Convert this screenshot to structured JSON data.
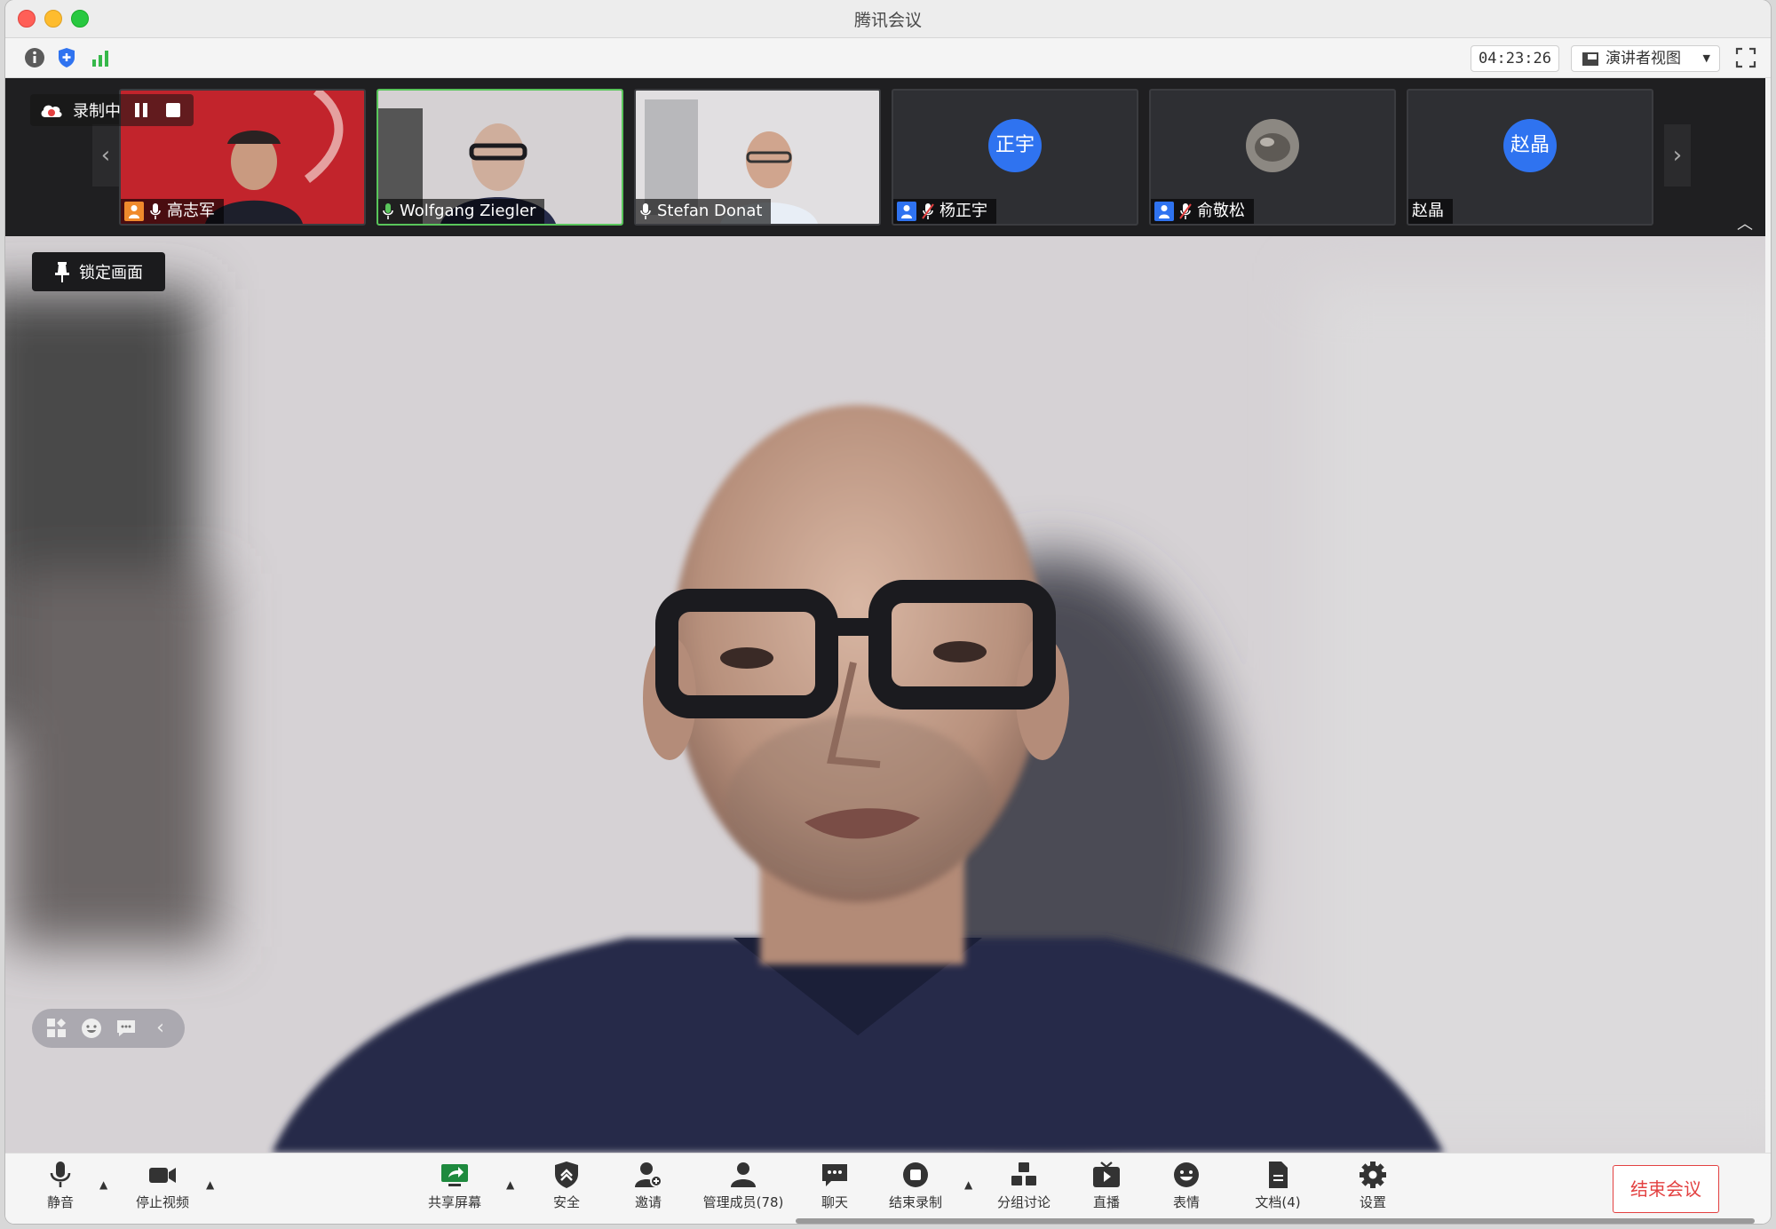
{
  "window": {
    "title": "腾讯会议"
  },
  "infobar": {
    "timer": "04:23:26",
    "view_mode": "演讲者视图",
    "icons": [
      "info-icon",
      "security-shield-icon",
      "network-signal-icon",
      "fullscreen-icon"
    ]
  },
  "recording": {
    "label": "录制中"
  },
  "participants": [
    {
      "name": "高志军",
      "video": true,
      "host": true,
      "mic": "on"
    },
    {
      "name": "Wolfgang Ziegler",
      "video": true,
      "active_speaker": true,
      "mic": "speaking"
    },
    {
      "name": "Stefan Donat",
      "video": true,
      "mic": "on"
    },
    {
      "name": "杨正宇",
      "avatar_text": "正宇",
      "mic": "muted",
      "badge": true
    },
    {
      "name": "俞敬松",
      "avatar_photo": true,
      "mic": "muted",
      "badge": true
    },
    {
      "name": "赵晶",
      "avatar_text": "赵晶",
      "mic": "none"
    }
  ],
  "lock_button": {
    "label": "锁定画面"
  },
  "toolbar": {
    "mute": "静音",
    "stop_video": "停止视频",
    "share_screen": "共享屏幕",
    "security": "安全",
    "invite": "邀请",
    "manage_members": "管理成员(78)",
    "chat": "聊天",
    "stop_recording": "结束录制",
    "breakout": "分组讨论",
    "live": "直播",
    "emoji": "表情",
    "docs": "文档(4)",
    "settings": "设置",
    "end_meeting": "结束会议"
  },
  "colors": {
    "accent_blue": "#2f73f0",
    "active_green": "#59c55b",
    "end_red": "#e34141",
    "host_orange": "#f08a2c"
  }
}
